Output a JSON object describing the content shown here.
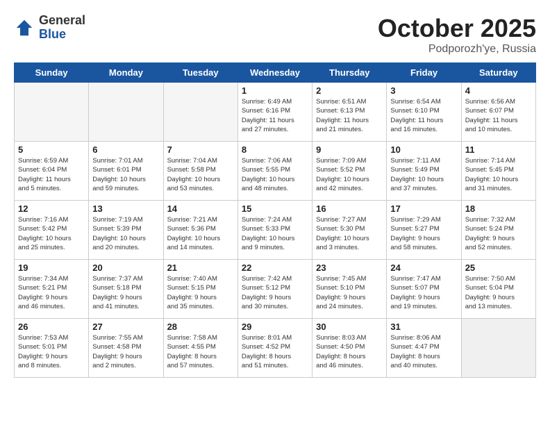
{
  "header": {
    "logo_general": "General",
    "logo_blue": "Blue",
    "month_title": "October 2025",
    "subtitle": "Podporozh'ye, Russia"
  },
  "weekdays": [
    "Sunday",
    "Monday",
    "Tuesday",
    "Wednesday",
    "Thursday",
    "Friday",
    "Saturday"
  ],
  "weeks": [
    [
      {
        "day": "",
        "info": ""
      },
      {
        "day": "",
        "info": ""
      },
      {
        "day": "",
        "info": ""
      },
      {
        "day": "1",
        "info": "Sunrise: 6:49 AM\nSunset: 6:16 PM\nDaylight: 11 hours\nand 27 minutes."
      },
      {
        "day": "2",
        "info": "Sunrise: 6:51 AM\nSunset: 6:13 PM\nDaylight: 11 hours\nand 21 minutes."
      },
      {
        "day": "3",
        "info": "Sunrise: 6:54 AM\nSunset: 6:10 PM\nDaylight: 11 hours\nand 16 minutes."
      },
      {
        "day": "4",
        "info": "Sunrise: 6:56 AM\nSunset: 6:07 PM\nDaylight: 11 hours\nand 10 minutes."
      }
    ],
    [
      {
        "day": "5",
        "info": "Sunrise: 6:59 AM\nSunset: 6:04 PM\nDaylight: 11 hours\nand 5 minutes."
      },
      {
        "day": "6",
        "info": "Sunrise: 7:01 AM\nSunset: 6:01 PM\nDaylight: 10 hours\nand 59 minutes."
      },
      {
        "day": "7",
        "info": "Sunrise: 7:04 AM\nSunset: 5:58 PM\nDaylight: 10 hours\nand 53 minutes."
      },
      {
        "day": "8",
        "info": "Sunrise: 7:06 AM\nSunset: 5:55 PM\nDaylight: 10 hours\nand 48 minutes."
      },
      {
        "day": "9",
        "info": "Sunrise: 7:09 AM\nSunset: 5:52 PM\nDaylight: 10 hours\nand 42 minutes."
      },
      {
        "day": "10",
        "info": "Sunrise: 7:11 AM\nSunset: 5:49 PM\nDaylight: 10 hours\nand 37 minutes."
      },
      {
        "day": "11",
        "info": "Sunrise: 7:14 AM\nSunset: 5:45 PM\nDaylight: 10 hours\nand 31 minutes."
      }
    ],
    [
      {
        "day": "12",
        "info": "Sunrise: 7:16 AM\nSunset: 5:42 PM\nDaylight: 10 hours\nand 25 minutes."
      },
      {
        "day": "13",
        "info": "Sunrise: 7:19 AM\nSunset: 5:39 PM\nDaylight: 10 hours\nand 20 minutes."
      },
      {
        "day": "14",
        "info": "Sunrise: 7:21 AM\nSunset: 5:36 PM\nDaylight: 10 hours\nand 14 minutes."
      },
      {
        "day": "15",
        "info": "Sunrise: 7:24 AM\nSunset: 5:33 PM\nDaylight: 10 hours\nand 9 minutes."
      },
      {
        "day": "16",
        "info": "Sunrise: 7:27 AM\nSunset: 5:30 PM\nDaylight: 10 hours\nand 3 minutes."
      },
      {
        "day": "17",
        "info": "Sunrise: 7:29 AM\nSunset: 5:27 PM\nDaylight: 9 hours\nand 58 minutes."
      },
      {
        "day": "18",
        "info": "Sunrise: 7:32 AM\nSunset: 5:24 PM\nDaylight: 9 hours\nand 52 minutes."
      }
    ],
    [
      {
        "day": "19",
        "info": "Sunrise: 7:34 AM\nSunset: 5:21 PM\nDaylight: 9 hours\nand 46 minutes."
      },
      {
        "day": "20",
        "info": "Sunrise: 7:37 AM\nSunset: 5:18 PM\nDaylight: 9 hours\nand 41 minutes."
      },
      {
        "day": "21",
        "info": "Sunrise: 7:40 AM\nSunset: 5:15 PM\nDaylight: 9 hours\nand 35 minutes."
      },
      {
        "day": "22",
        "info": "Sunrise: 7:42 AM\nSunset: 5:12 PM\nDaylight: 9 hours\nand 30 minutes."
      },
      {
        "day": "23",
        "info": "Sunrise: 7:45 AM\nSunset: 5:10 PM\nDaylight: 9 hours\nand 24 minutes."
      },
      {
        "day": "24",
        "info": "Sunrise: 7:47 AM\nSunset: 5:07 PM\nDaylight: 9 hours\nand 19 minutes."
      },
      {
        "day": "25",
        "info": "Sunrise: 7:50 AM\nSunset: 5:04 PM\nDaylight: 9 hours\nand 13 minutes."
      }
    ],
    [
      {
        "day": "26",
        "info": "Sunrise: 7:53 AM\nSunset: 5:01 PM\nDaylight: 9 hours\nand 8 minutes."
      },
      {
        "day": "27",
        "info": "Sunrise: 7:55 AM\nSunset: 4:58 PM\nDaylight: 9 hours\nand 2 minutes."
      },
      {
        "day": "28",
        "info": "Sunrise: 7:58 AM\nSunset: 4:55 PM\nDaylight: 8 hours\nand 57 minutes."
      },
      {
        "day": "29",
        "info": "Sunrise: 8:01 AM\nSunset: 4:52 PM\nDaylight: 8 hours\nand 51 minutes."
      },
      {
        "day": "30",
        "info": "Sunrise: 8:03 AM\nSunset: 4:50 PM\nDaylight: 8 hours\nand 46 minutes."
      },
      {
        "day": "31",
        "info": "Sunrise: 8:06 AM\nSunset: 4:47 PM\nDaylight: 8 hours\nand 40 minutes."
      },
      {
        "day": "",
        "info": ""
      }
    ]
  ]
}
